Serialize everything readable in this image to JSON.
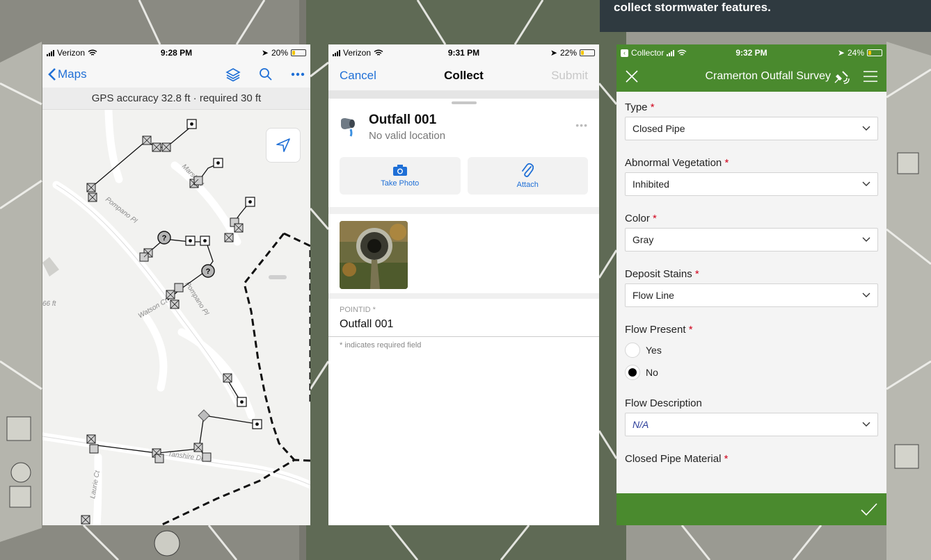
{
  "caption": {
    "text": "collect stormwater features."
  },
  "phone_maps": {
    "status": {
      "carrier": "Verizon",
      "time": "9:28 PM",
      "battery": "20%",
      "battery_level": 0.2
    },
    "nav": {
      "back_label": "Maps"
    },
    "gps_text": "GPS accuracy 32.8 ft · required 30 ft",
    "map": {
      "labels": [
        "Pompano Pl",
        "Marsh St",
        "Pompano Pl",
        "Watson Ct",
        "Tanshire Dr",
        "Laurie Ct",
        "66 ft"
      ],
      "unknown_marker": "?"
    },
    "fab_label": "+"
  },
  "phone_collect": {
    "status": {
      "carrier": "Verizon",
      "time": "9:31 PM",
      "battery": "22%",
      "battery_level": 0.22
    },
    "nav": {
      "cancel": "Cancel",
      "title": "Collect",
      "submit": "Submit"
    },
    "feature": {
      "title": "Outfall 001",
      "subtitle": "No valid location",
      "more": "•••"
    },
    "actions": {
      "take_photo": "Take Photo",
      "attach": "Attach"
    },
    "field": {
      "label": "POINTID *",
      "value": "Outfall 001",
      "hint": "* indicates required field"
    }
  },
  "phone_survey": {
    "status": {
      "back_app": "Collector",
      "time": "9:32 PM",
      "battery": "24%",
      "battery_level": 0.24
    },
    "title": "Cramerton Outfall Survey",
    "questions": [
      {
        "label": "Type",
        "required": "*",
        "value": "Closed Pipe"
      },
      {
        "label": "Abnormal Vegetation",
        "required": "*",
        "value": "Inhibited"
      },
      {
        "label": "Color",
        "required": "*",
        "value": "Gray"
      },
      {
        "label": "Deposit Stains",
        "required": "*",
        "value": "Flow Line"
      }
    ],
    "flow_present": {
      "label": "Flow Present",
      "required": "*",
      "options": [
        "Yes",
        "No"
      ],
      "selected": "No"
    },
    "flow_description": {
      "label": "Flow Description",
      "value": "N/A"
    },
    "pipe_material": {
      "label": "Closed Pipe Material",
      "required": "*"
    }
  },
  "colors": {
    "ios_blue": "#1f6fd6",
    "survey_green": "#4a8a2e",
    "fab_blue": "#2e73c4",
    "required_red": "#d0021b"
  }
}
